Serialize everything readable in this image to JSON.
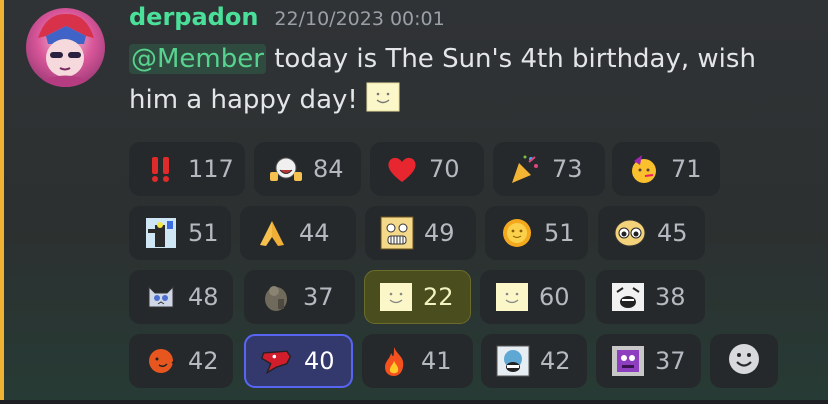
{
  "message": {
    "username": "derpadon",
    "timestamp": "22/10/2023 00:01",
    "mention": "@Member",
    "text_line1": " today is The Sun's 4th birthday, wish",
    "text_line2": "him a happy day! ",
    "inline_emoji": "sun-face-emoji"
  },
  "reactions": [
    {
      "emoji": "double-exclamation",
      "count": "117"
    },
    {
      "emoji": "laughing-thumbsup-face",
      "count": "84"
    },
    {
      "emoji": "red-heart",
      "count": "70"
    },
    {
      "emoji": "party-popper",
      "count": "73"
    },
    {
      "emoji": "partying-face",
      "count": "71"
    },
    {
      "emoji": "character-pointing",
      "count": "51"
    },
    {
      "emoji": "folded-hands",
      "count": "44"
    },
    {
      "emoji": "grinning-square-face",
      "count": "49"
    },
    {
      "emoji": "sun-with-face",
      "count": "51"
    },
    {
      "emoji": "pleading-cartoon-face",
      "count": "45"
    },
    {
      "emoji": "cat-creature",
      "count": "48"
    },
    {
      "emoji": "rock-figure",
      "count": "37"
    },
    {
      "emoji": "sun-face-yellow",
      "count": "22",
      "selected": true
    },
    {
      "emoji": "sun-face-pale",
      "count": "60"
    },
    {
      "emoji": "screaming-sketch",
      "count": "38"
    },
    {
      "emoji": "orange-ball",
      "count": "42"
    },
    {
      "emoji": "red-bird",
      "count": "40",
      "selected": true
    },
    {
      "emoji": "fire",
      "count": "41"
    },
    {
      "emoji": "shouting-face",
      "count": "42"
    },
    {
      "emoji": "purple-cube-creature",
      "count": "37"
    }
  ],
  "add_reaction_icon": "smiley-face-icon",
  "colors": {
    "username": "#4be09a",
    "accent_stripe": "#f0b232",
    "selected_blue": "#5865f2"
  }
}
